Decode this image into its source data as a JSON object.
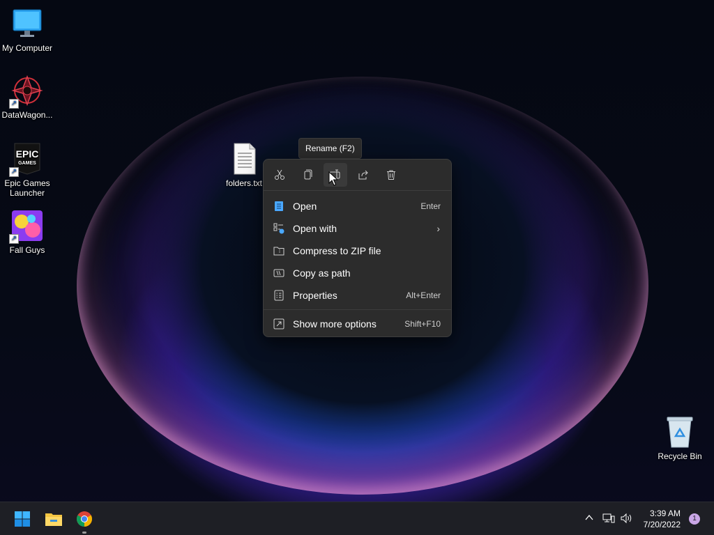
{
  "desktop": {
    "icons": [
      {
        "label": "My Computer",
        "icon": "monitor-icon"
      },
      {
        "label": "DataWagon...",
        "icon": "datawagon-app-icon"
      },
      {
        "label": "Epic Games\nLauncher",
        "label_line1": "Epic Games",
        "label_line2": "Launcher",
        "icon": "epic-games-icon",
        "logo_text_1": "EPIC",
        "logo_text_2": "GAMES"
      },
      {
        "label": "Fall Guys",
        "icon": "fall-guys-icon"
      },
      {
        "label": "folders.txt",
        "icon": "text-file-icon"
      },
      {
        "label": "Recycle Bin",
        "icon": "recycle-bin-icon"
      }
    ]
  },
  "tooltip": {
    "text": "Rename (F2)"
  },
  "context_menu": {
    "toolbar": [
      {
        "name": "cut",
        "icon": "scissors-icon"
      },
      {
        "name": "copy",
        "icon": "copy-icon"
      },
      {
        "name": "rename",
        "icon": "rename-icon",
        "hovered": true
      },
      {
        "name": "share",
        "icon": "share-icon"
      },
      {
        "name": "delete",
        "icon": "trash-icon"
      }
    ],
    "items": [
      {
        "label": "Open",
        "shortcut": "Enter",
        "icon": "open-doc-icon"
      },
      {
        "label": "Open with",
        "shortcut": "",
        "icon": "open-with-icon",
        "submenu": true
      },
      {
        "label": "Compress to ZIP file",
        "shortcut": "",
        "icon": "zip-folder-icon"
      },
      {
        "label": "Copy as path",
        "shortcut": "",
        "icon": "copy-path-icon"
      },
      {
        "label": "Properties",
        "shortcut": "Alt+Enter",
        "icon": "properties-icon"
      },
      {
        "label": "Show more options",
        "shortcut": "Shift+F10",
        "icon": "more-options-icon"
      }
    ]
  },
  "taskbar": {
    "apps": [
      {
        "name": "start",
        "icon": "windows-start-icon"
      },
      {
        "name": "file-explorer",
        "icon": "folder-icon"
      },
      {
        "name": "chrome",
        "icon": "chrome-icon",
        "running": true
      }
    ],
    "tray": {
      "chevron": "chevron-up-icon",
      "network": "network-icon",
      "volume": "speaker-icon"
    },
    "clock": {
      "time": "3:39 AM",
      "date": "7/20/2022"
    },
    "notification_count": "1"
  },
  "colors": {
    "accent": "#4cc2ff",
    "menu_bg": "#2c2c2c",
    "taskbar_bg": "#1e1f25"
  }
}
